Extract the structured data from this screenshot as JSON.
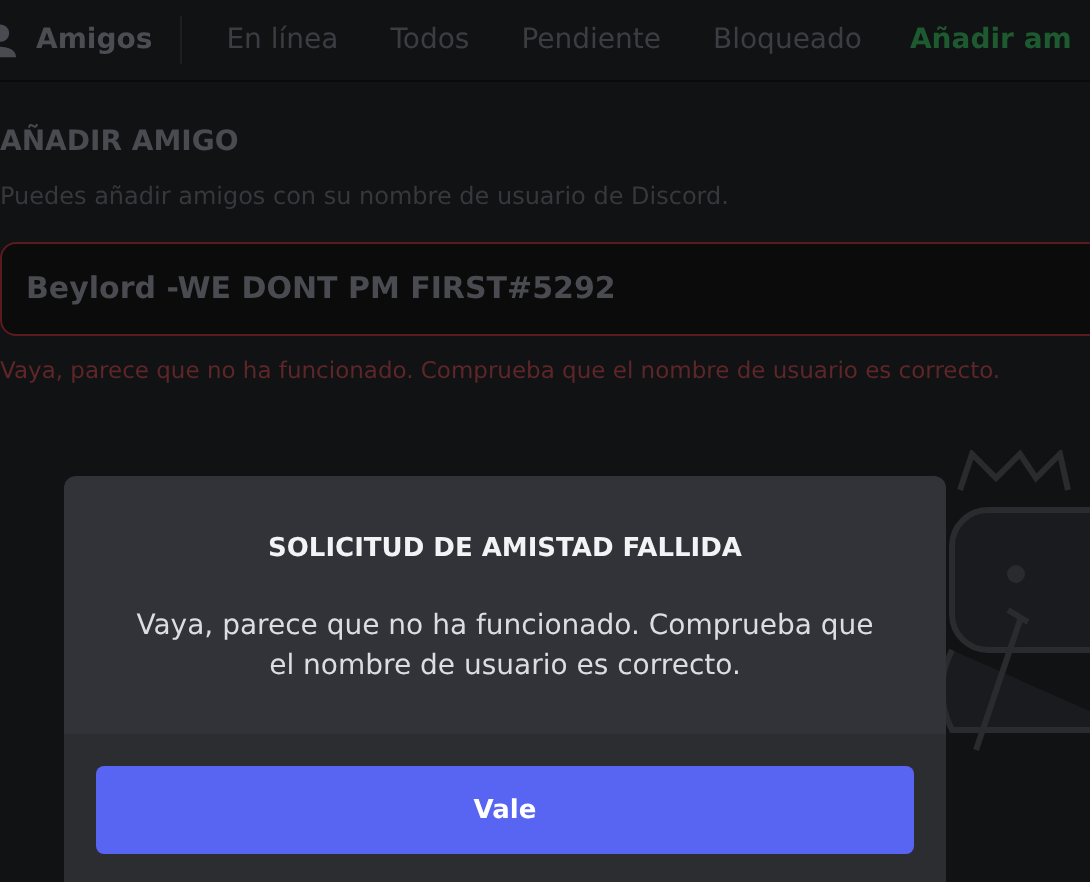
{
  "header": {
    "title": "Amigos",
    "tabs": [
      {
        "label": "En línea",
        "selected": false
      },
      {
        "label": "Todos",
        "selected": false
      },
      {
        "label": "Pendiente",
        "selected": false
      },
      {
        "label": "Bloqueado",
        "selected": false
      }
    ],
    "add_friend_button": "Añadir am"
  },
  "add_friend": {
    "heading": "AÑADIR AMIGO",
    "description": "Puedes añadir amigos con su nombre de usuario de Discord.",
    "input": {
      "value": "Beylord -WE DONT PM FIRST#5292",
      "error": true
    },
    "error_message": "Vaya, parece que no ha funcionado. Comprueba que el nombre de usuario es correcto."
  },
  "dialog": {
    "title": "SOLICITUD DE AMISTAD FALLIDA",
    "message": "Vaya, parece que no ha funcionado. Comprueba que el nombre de usuario es correcto.",
    "button": "Vale"
  }
}
